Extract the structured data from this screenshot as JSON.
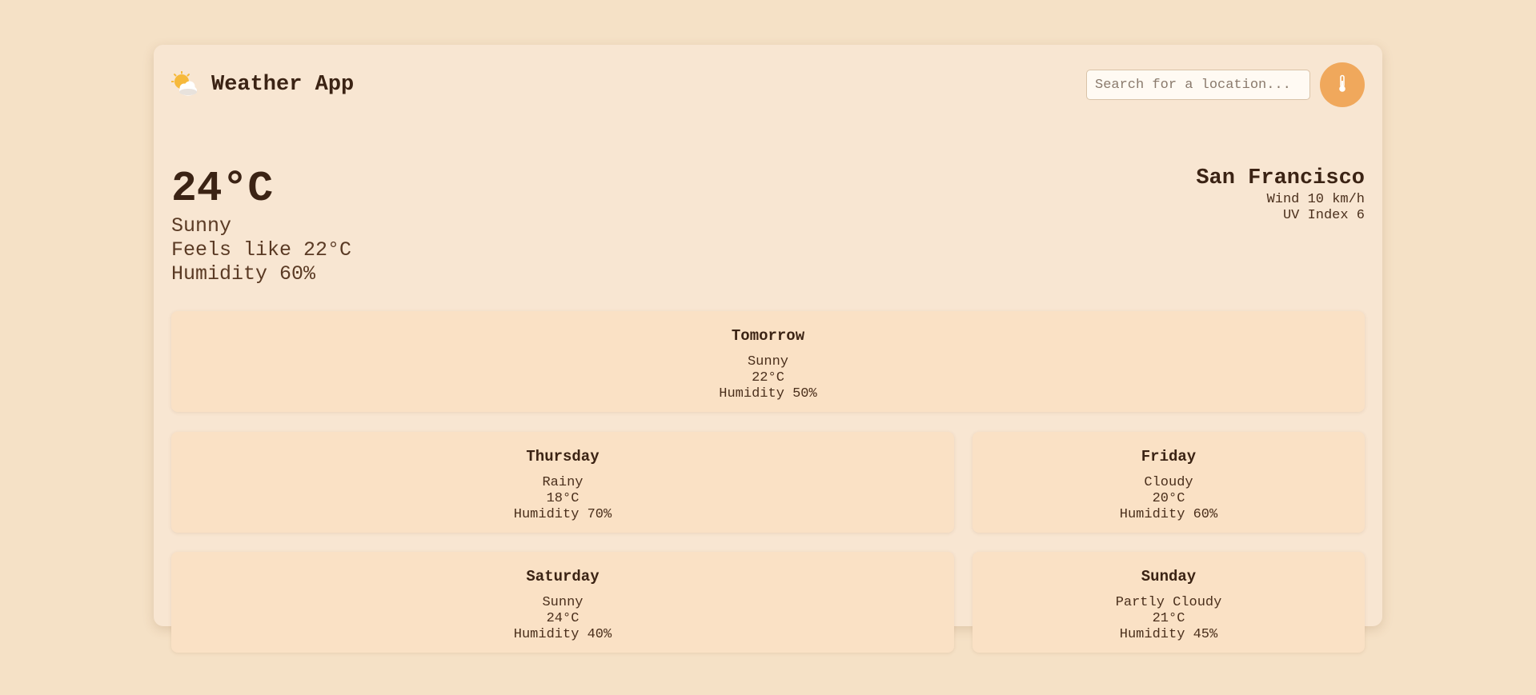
{
  "header": {
    "title": "Weather App",
    "logo_icon": "sun-behind-cloud-icon",
    "search": {
      "placeholder": "Search for a location...",
      "value": ""
    },
    "search_button_icon": "thermometer-icon"
  },
  "current": {
    "temperature": "24°C",
    "condition": "Sunny",
    "feels_like": "Feels like 22°C",
    "humidity": "Humidity 60%"
  },
  "location": {
    "city": "San Francisco",
    "wind": "Wind 10 km/h",
    "uv_index": "UV Index 6"
  },
  "forecast": [
    {
      "day": "Tomorrow",
      "condition": "Sunny",
      "temp": "22°C",
      "humidity": "Humidity 50%"
    },
    {
      "day": "Thursday",
      "condition": "Rainy",
      "temp": "18°C",
      "humidity": "Humidity 70%"
    },
    {
      "day": "Friday",
      "condition": "Cloudy",
      "temp": "20°C",
      "humidity": "Humidity 60%"
    },
    {
      "day": "Saturday",
      "condition": "Sunny",
      "temp": "24°C",
      "humidity": "Humidity 40%"
    },
    {
      "day": "Sunday",
      "condition": "Partly Cloudy",
      "temp": "21°C",
      "humidity": "Humidity 45%"
    }
  ],
  "colors": {
    "background": "#f5e1c6",
    "card": "#f8e6d2",
    "forecast_card": "#fae1c5",
    "accent": "#f0a85c",
    "text": "#3b2314"
  }
}
